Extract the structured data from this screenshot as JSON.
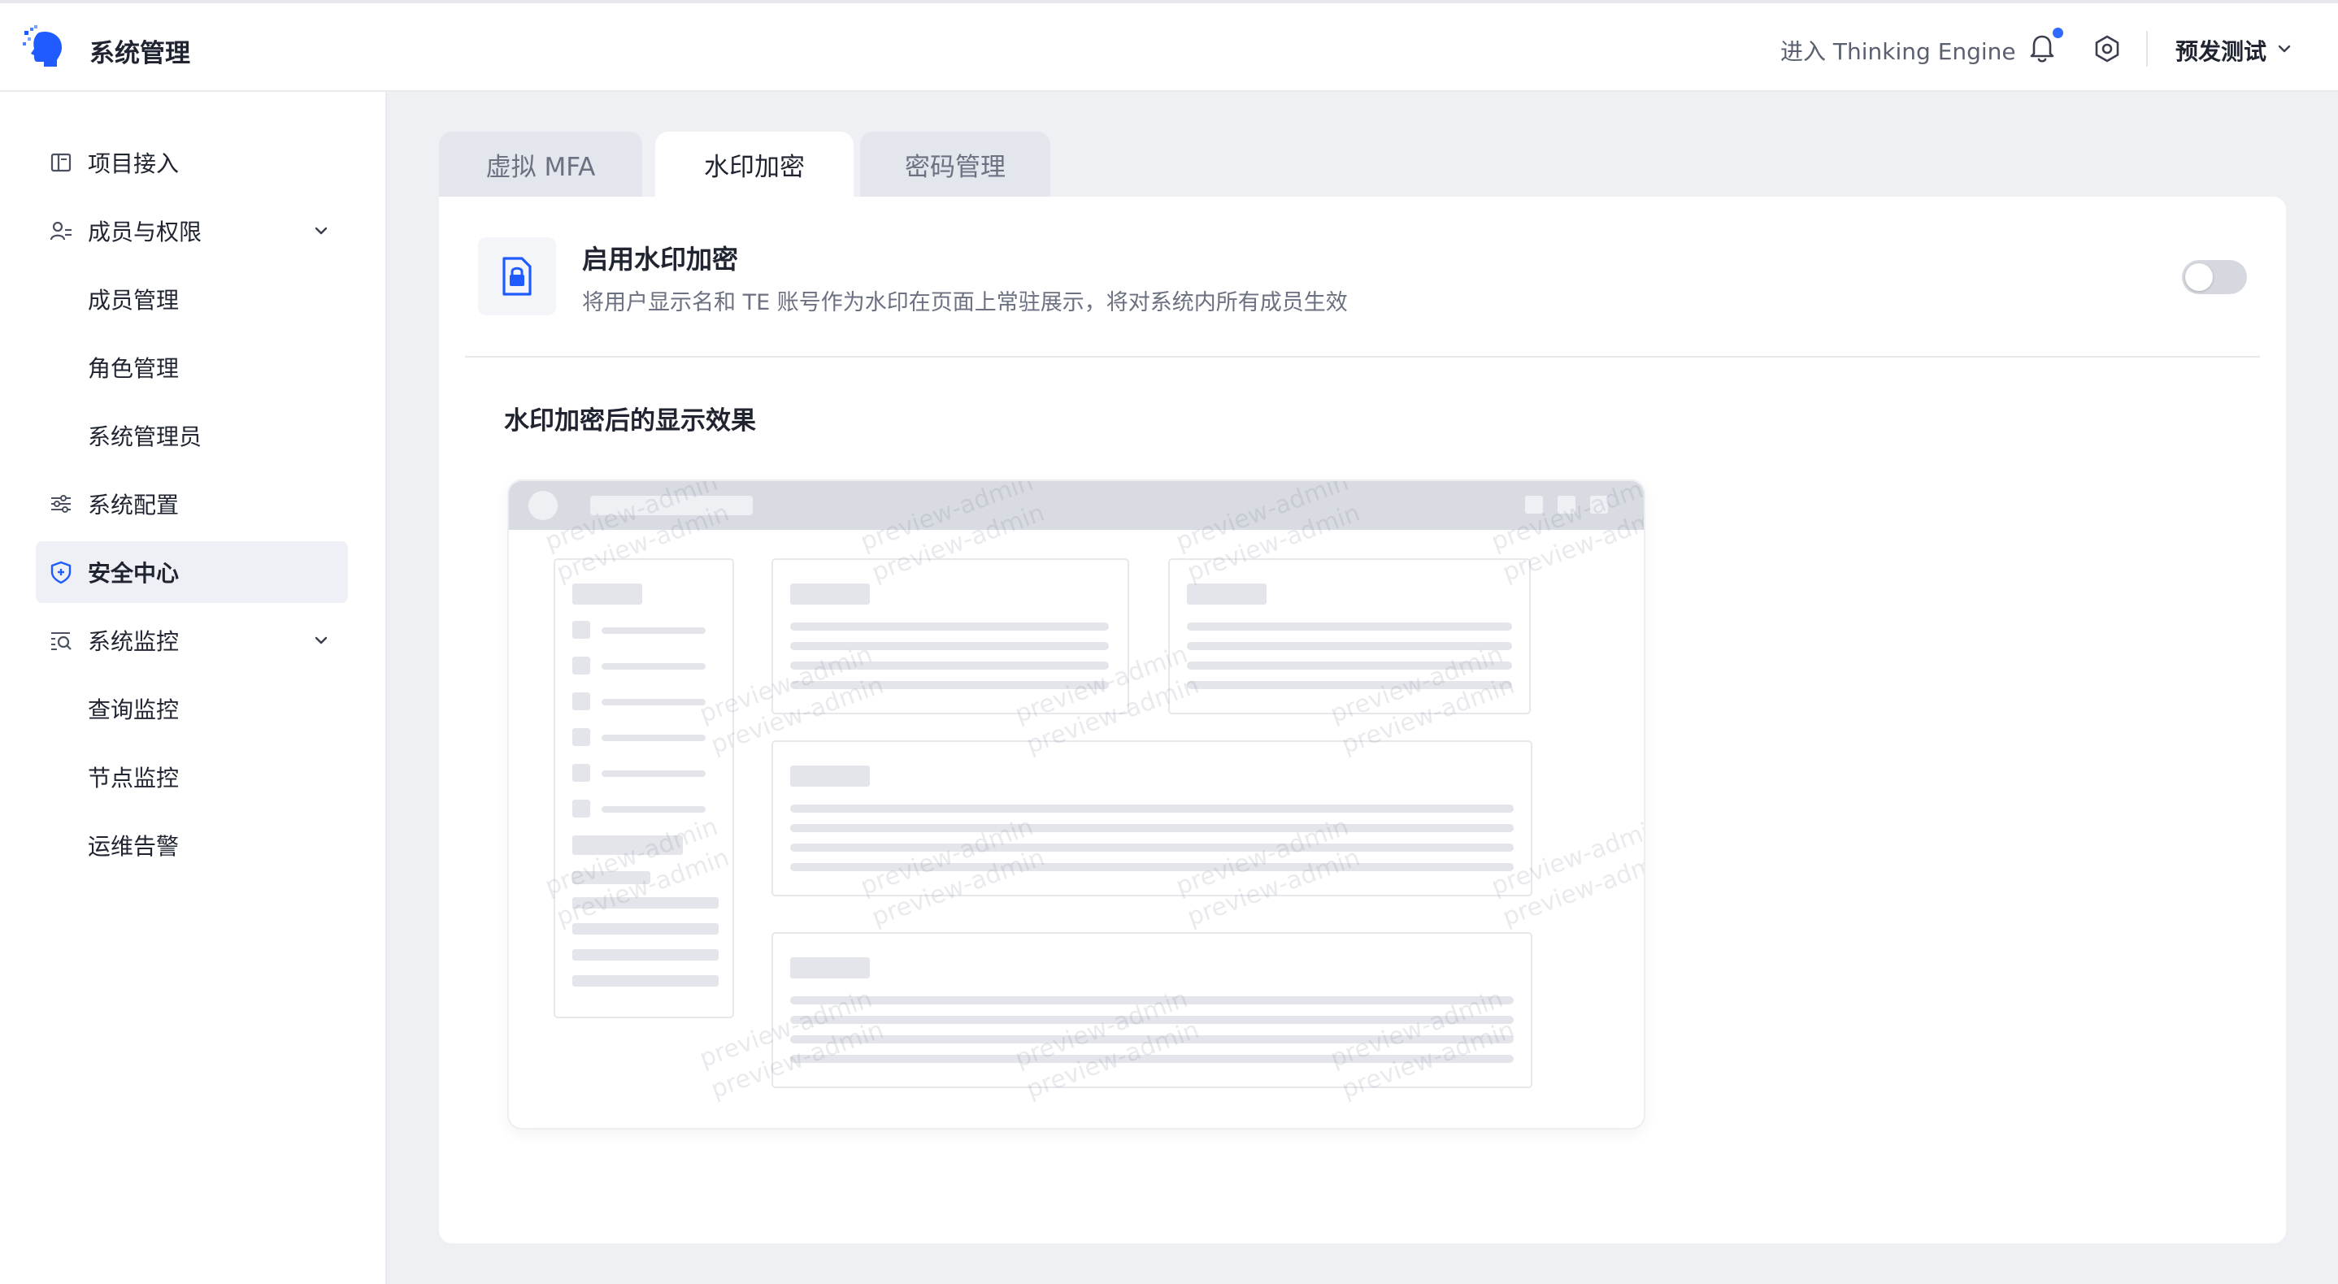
{
  "header": {
    "title": "系统管理",
    "enter_link": "进入 Thinking Engine",
    "workspace": "预发测试"
  },
  "sidebar": {
    "items": [
      {
        "label": "项目接入",
        "icon": "layout-icon"
      },
      {
        "label": "成员与权限",
        "icon": "users-icon",
        "expanded": true
      },
      {
        "label": "成员管理",
        "sub": true
      },
      {
        "label": "角色管理",
        "sub": true
      },
      {
        "label": "系统管理员",
        "sub": true
      },
      {
        "label": "系统配置",
        "icon": "sliders-icon"
      },
      {
        "label": "安全中心",
        "icon": "shield-icon",
        "active": true
      },
      {
        "label": "系统监控",
        "icon": "monitor-icon",
        "expanded": true
      },
      {
        "label": "查询监控",
        "sub": true
      },
      {
        "label": "节点监控",
        "sub": true
      },
      {
        "label": "运维告警",
        "sub": true
      }
    ]
  },
  "tabs": [
    {
      "label": "虚拟 MFA"
    },
    {
      "label": "水印加密",
      "active": true
    },
    {
      "label": "密码管理"
    }
  ],
  "feature": {
    "title": "启用水印加密",
    "description": "将用户显示名和 TE 账号作为水印在页面上常驻展示，将对系统内所有成员生效",
    "enabled": false
  },
  "preview": {
    "title": "水印加密后的显示效果",
    "watermark_text": "preview-admin"
  },
  "colors": {
    "accent": "#2f6bff",
    "toggle_off": "#d5d8df",
    "background": "#eef0f4"
  }
}
